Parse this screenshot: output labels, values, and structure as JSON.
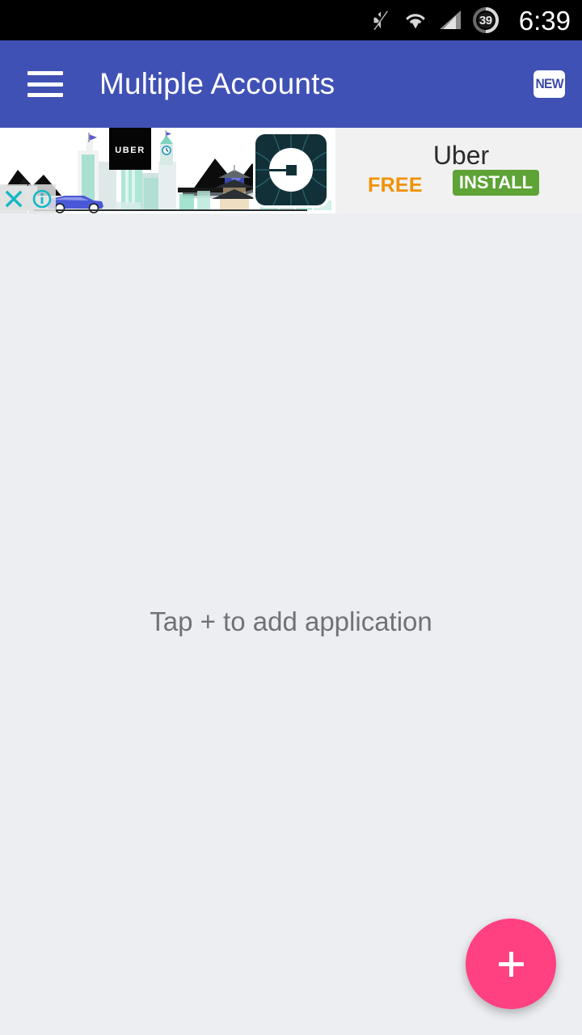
{
  "status_bar": {
    "icons": [
      "mute-icon",
      "wifi-icon",
      "cellular-signal-icon",
      "battery-icon"
    ],
    "battery_level": "39",
    "time": "6:39",
    "background": "#000000"
  },
  "app_bar": {
    "menu_icon": "hamburger-menu-icon",
    "title": "Multiple Accounts",
    "new_badge_label": "NEW",
    "background": "#4051B5",
    "text_color": "#FFFFFF"
  },
  "ad": {
    "logo_text": "UBER",
    "app_icon": "uber-app-icon",
    "title": "Uber",
    "price_label": "FREE",
    "install_label": "INSTALL",
    "close_icon": "ad-close-icon",
    "info_icon": "ad-info-icon",
    "install_color": "#5EA335",
    "price_color": "#F09100",
    "background": "#F1F1F1"
  },
  "main": {
    "empty_state_text": "Tap + to add application",
    "empty_state_color": "#6F7277",
    "background": "#EDEEF2"
  },
  "fab": {
    "icon": "plus-icon",
    "color": "#FF4181"
  }
}
